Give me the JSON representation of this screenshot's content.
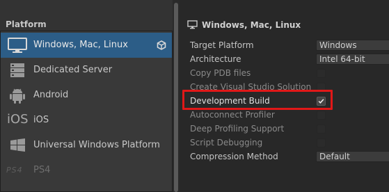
{
  "left": {
    "header": "Platform",
    "items": [
      {
        "label": "Windows, Mac, Linux",
        "icon": "monitor-icon",
        "selected": true
      },
      {
        "label": "Dedicated Server",
        "icon": "server-icon"
      },
      {
        "label": "Android",
        "icon": "android-icon"
      },
      {
        "label": "iOS",
        "icon": "ios-icon",
        "icon_text": "iOS"
      },
      {
        "label": "Universal Windows Platform",
        "icon": "windows-icon"
      },
      {
        "label": "PS4",
        "icon": "ps4-icon",
        "icon_text": "PS4"
      }
    ]
  },
  "settings": {
    "title": "Windows, Mac, Linux",
    "title_icon": "monitor-icon",
    "rows": [
      {
        "label": "Target Platform",
        "type": "dropdown",
        "value": "Windows"
      },
      {
        "label": "Architecture",
        "type": "dropdown",
        "value": "Intel 64-bit"
      },
      {
        "label": "Copy PDB files",
        "type": "checkbox",
        "checked": false
      },
      {
        "label": "Create Visual Studio Solution",
        "type": "checkbox",
        "checked": false
      },
      {
        "label": "Development Build",
        "type": "checkbox",
        "checked": true,
        "highlighted": true
      },
      {
        "label": "Autoconnect Profiler",
        "type": "checkbox",
        "checked": false
      },
      {
        "label": "Deep Profiling Support",
        "type": "checkbox",
        "checked": false
      },
      {
        "label": "Script Debugging",
        "type": "checkbox",
        "checked": false
      },
      {
        "label": "Compression Method",
        "type": "dropdown",
        "value": "Default"
      }
    ]
  },
  "colors": {
    "selection": "#2c5d87",
    "highlight": "#e01818"
  }
}
